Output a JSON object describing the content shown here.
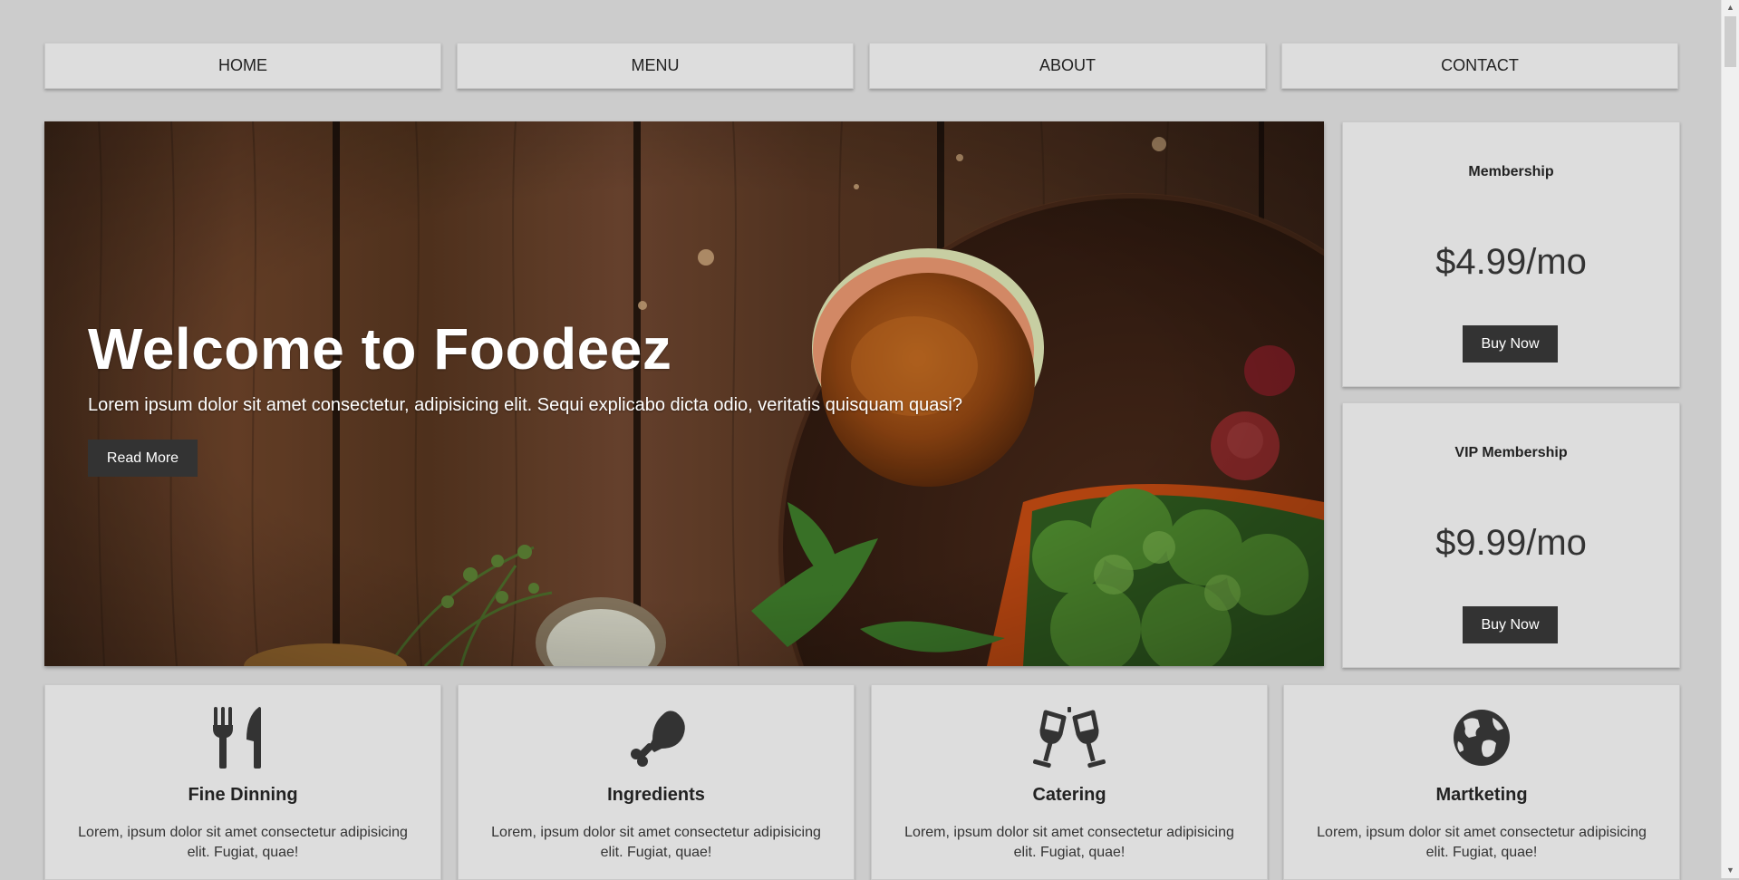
{
  "nav": {
    "items": [
      {
        "label": "HOME"
      },
      {
        "label": "MENU"
      },
      {
        "label": "ABOUT"
      },
      {
        "label": "CONTACT"
      }
    ]
  },
  "hero": {
    "title": "Welcome to Foodeez",
    "text": "Lorem ipsum dolor sit amet consectetur, adipisicing elit. Sequi explicabo dicta odio, veritatis quisquam quasi?",
    "button_label": "Read More"
  },
  "pricing": [
    {
      "plan": "Membership",
      "price": "$4.99/mo",
      "button_label": "Buy Now"
    },
    {
      "plan": "VIP Membership",
      "price": "$9.99/mo",
      "button_label": "Buy Now"
    }
  ],
  "features": [
    {
      "icon": "utensils-icon",
      "title": "Fine Dinning",
      "text": "Lorem, ipsum dolor sit amet consectetur adipisicing elit. Fugiat, quae!"
    },
    {
      "icon": "drumstick-icon",
      "title": "Ingredients",
      "text": "Lorem, ipsum dolor sit amet consectetur adipisicing elit. Fugiat, quae!"
    },
    {
      "icon": "glass-cheers-icon",
      "title": "Catering",
      "text": "Lorem, ipsum dolor sit amet consectetur adipisicing elit. Fugiat, quae!"
    },
    {
      "icon": "globe-icon",
      "title": "Martketing",
      "text": "Lorem, ipsum dolor sit amet consectetur adipisicing elit. Fugiat, quae!"
    }
  ],
  "colors": {
    "page_bg": "#cccccc",
    "card_bg": "#dddddd",
    "button_bg": "#333333",
    "text": "#333333"
  }
}
